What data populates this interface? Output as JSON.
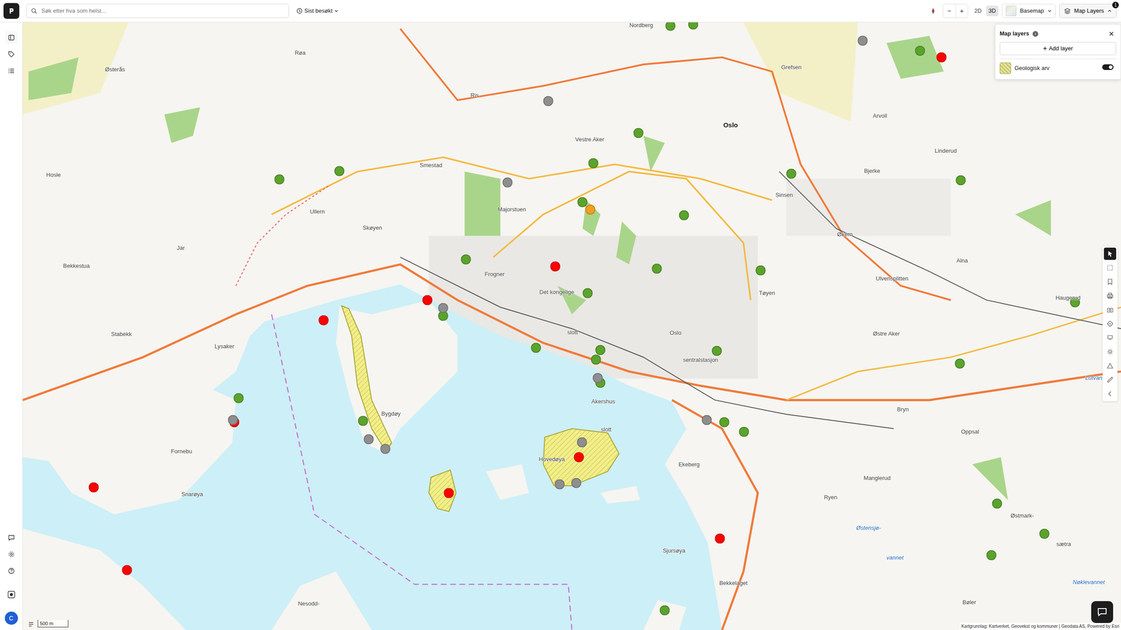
{
  "topbar": {
    "search": {
      "placeholder": "Søk etter hva som helst..."
    },
    "recent": {
      "label": "Sist besøkt"
    },
    "zoom_out": "−",
    "zoom_in": "+",
    "view_modes": [
      {
        "label": "2D",
        "selected": false
      },
      {
        "label": "3D",
        "selected": true
      }
    ],
    "basemap": {
      "label": "Basemap"
    },
    "map_layers": {
      "label": "Map Layers",
      "badge": "1",
      "expanded": true
    }
  },
  "sidebar": {
    "avatar": "C"
  },
  "layers_panel": {
    "title": "Map layers",
    "close": "×",
    "add_button": {
      "icon": "+",
      "label": "Add layer"
    },
    "layers": [
      {
        "name": "Geologisk arv",
        "on": true
      }
    ]
  },
  "map_tools": [
    {
      "selected": true
    },
    {
      "selected": false
    },
    {
      "selected": false
    },
    {
      "selected": false
    },
    {
      "selected": false
    },
    {
      "selected": false
    },
    {
      "selected": false
    },
    {
      "selected": false
    },
    {
      "selected": false
    },
    {
      "selected": false
    },
    {
      "selected": false
    }
  ],
  "map": {
    "labels": [
      {
        "text": "Nordberg",
        "kind": "place"
      },
      {
        "text": "Røa",
        "kind": "place"
      },
      {
        "text": "Grefsen",
        "kind": "place"
      },
      {
        "text": "Østerås",
        "kind": "place"
      },
      {
        "text": "Ris",
        "kind": "place"
      },
      {
        "text": "Oslo",
        "kind": "major"
      },
      {
        "text": "Arvoll",
        "kind": "place"
      },
      {
        "text": "Vestre Aker",
        "kind": "place"
      },
      {
        "text": "Linderud",
        "kind": "place"
      },
      {
        "text": "Smestad",
        "kind": "place"
      },
      {
        "text": "Bjerke",
        "kind": "place"
      },
      {
        "text": "Hosle",
        "kind": "place"
      },
      {
        "text": "Sinsen",
        "kind": "place"
      },
      {
        "text": "Majorstuen",
        "kind": "place"
      },
      {
        "text": "Ullern",
        "kind": "place"
      },
      {
        "text": "Skøyen",
        "kind": "place"
      },
      {
        "text": "Økern",
        "kind": "place"
      },
      {
        "text": "Jar",
        "kind": "place"
      },
      {
        "text": "Alna",
        "kind": "place"
      },
      {
        "text": "Bekkestua",
        "kind": "place"
      },
      {
        "text": "Frogner",
        "kind": "place"
      },
      {
        "text": "Ulvensplitten",
        "kind": "place"
      },
      {
        "text": "Det kongelige",
        "kind": "place"
      },
      {
        "text": "Tøyen",
        "kind": "place"
      },
      {
        "text": "Haugerud",
        "kind": "place"
      },
      {
        "text": "slott",
        "kind": "place"
      },
      {
        "text": "Oslo",
        "kind": "place"
      },
      {
        "text": "Østre Aker",
        "kind": "place"
      },
      {
        "text": "Stabekk",
        "kind": "place"
      },
      {
        "text": "Lysaker",
        "kind": "place"
      },
      {
        "text": "sentralstasjon",
        "kind": "place"
      },
      {
        "text": "Lutvan",
        "kind": "water"
      },
      {
        "text": "Akershus",
        "kind": "place"
      },
      {
        "text": "Bryn",
        "kind": "place"
      },
      {
        "text": "Bygdøy",
        "kind": "place"
      },
      {
        "text": "slott",
        "kind": "place"
      },
      {
        "text": "Oppsal",
        "kind": "place"
      },
      {
        "text": "Fornebu",
        "kind": "place"
      },
      {
        "text": "Hovedøya",
        "kind": "place"
      },
      {
        "text": "Ekeberg",
        "kind": "place"
      },
      {
        "text": "Manglerud",
        "kind": "place"
      },
      {
        "text": "Snarøya",
        "kind": "place"
      },
      {
        "text": "Ryen",
        "kind": "place"
      },
      {
        "text": "Østmark-",
        "kind": "place"
      },
      {
        "text": "Østensjø-",
        "kind": "water"
      },
      {
        "text": "sætra",
        "kind": "place"
      },
      {
        "text": "Sjursøya",
        "kind": "place"
      },
      {
        "text": "vannet",
        "kind": "water"
      },
      {
        "text": "Nøklevannet",
        "kind": "water"
      },
      {
        "text": "Bekkelaget",
        "kind": "place"
      },
      {
        "text": "Bøler",
        "kind": "place"
      },
      {
        "text": "Nesodd-",
        "kind": "place"
      }
    ],
    "pins": [
      {
        "color": "#ff0000"
      },
      {
        "color": "#ff0000"
      },
      {
        "color": "#ff0000"
      },
      {
        "color": "#ff0000"
      },
      {
        "color": "#ff0000"
      },
      {
        "color": "#ff0000"
      },
      {
        "color": "#ff0000"
      },
      {
        "color": "#ff0000"
      },
      {
        "color": "#ff0000"
      },
      {
        "color": "#ff0000"
      },
      {
        "color": "#5ca32e"
      },
      {
        "color": "#5ca32e"
      },
      {
        "color": "#5ca32e"
      },
      {
        "color": "#5ca32e"
      },
      {
        "color": "#5ca32e"
      },
      {
        "color": "#5ca32e"
      },
      {
        "color": "#5ca32e"
      },
      {
        "color": "#5ca32e"
      },
      {
        "color": "#5ca32e"
      },
      {
        "color": "#5ca32e"
      },
      {
        "color": "#5ca32e"
      },
      {
        "color": "#5ca32e"
      },
      {
        "color": "#5ca32e"
      },
      {
        "color": "#5ca32e"
      },
      {
        "color": "#5ca32e"
      },
      {
        "color": "#5ca32e"
      },
      {
        "color": "#5ca32e"
      },
      {
        "color": "#5ca32e"
      },
      {
        "color": "#5ca32e"
      },
      {
        "color": "#5ca32e"
      },
      {
        "color": "#5ca32e"
      },
      {
        "color": "#5ca32e"
      },
      {
        "color": "#5ca32e"
      },
      {
        "color": "#5ca32e"
      },
      {
        "color": "#5ca32e"
      },
      {
        "color": "#5ca32e"
      },
      {
        "color": "#5ca32e"
      },
      {
        "color": "#5ca32e"
      },
      {
        "color": "#5ca32e"
      },
      {
        "color": "#5ca32e"
      },
      {
        "color": "#5ca32e"
      },
      {
        "color": "#8e8e8e"
      },
      {
        "color": "#8e8e8e"
      },
      {
        "color": "#8e8e8e"
      },
      {
        "color": "#8e8e8e"
      },
      {
        "color": "#8e8e8e"
      },
      {
        "color": "#8e8e8e"
      },
      {
        "color": "#8e8e8e"
      },
      {
        "color": "#8e8e8e"
      },
      {
        "color": "#8e8e8e"
      },
      {
        "color": "#8e8e8e"
      },
      {
        "color": "#8e8e8e"
      },
      {
        "color": "#8e8e8e"
      },
      {
        "color": "#f0a020"
      }
    ],
    "scale": "500 m",
    "attribution": "Kartgrunnlag: Kartverket, Geovekst og kommuner | Geodata AS, Powered by Esri"
  }
}
